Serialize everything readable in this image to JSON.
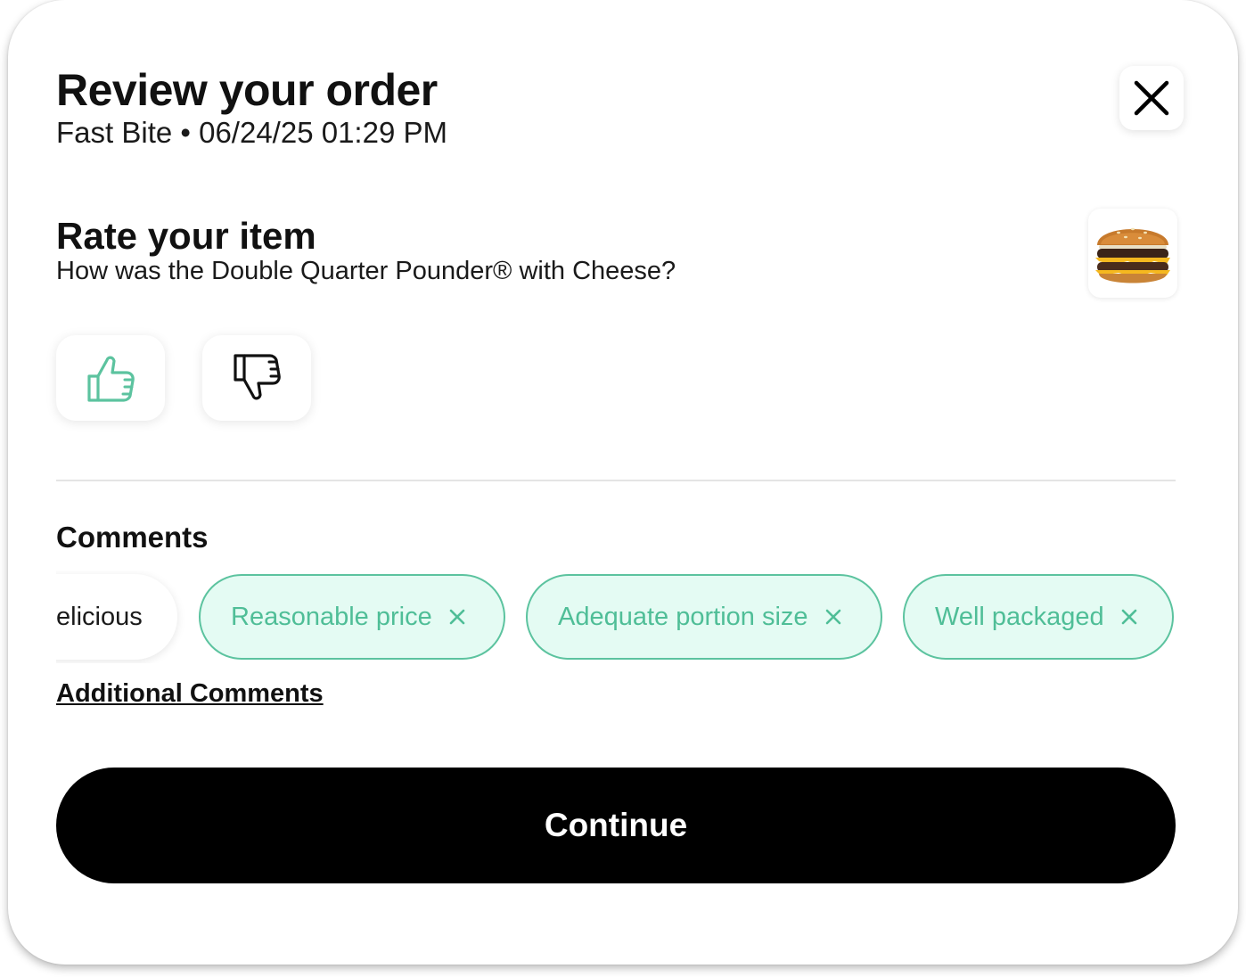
{
  "header": {
    "title": "Review your order",
    "subtitle": "Fast Bite • 06/24/25 01:29 PM",
    "close_icon": "close-icon"
  },
  "rate_item": {
    "title": "Rate your item",
    "question": "How was the Double Quarter Pounder® with Cheese?",
    "item_image_icon": "burger-image",
    "thumbs_up_icon": "thumbs-up-icon",
    "thumbs_down_icon": "thumbs-down-icon",
    "accent_color": "#5cc39f"
  },
  "comments": {
    "title": "Comments",
    "chips": [
      {
        "label": "elicious",
        "selected": false
      },
      {
        "label": "Reasonable price",
        "selected": true
      },
      {
        "label": "Adequate portion size",
        "selected": true
      },
      {
        "label": "Well packaged",
        "selected": true
      }
    ],
    "additional_label": "Additional Comments"
  },
  "footer": {
    "continue_label": "Continue"
  },
  "colors": {
    "chip_selected_bg": "#e4fbf3",
    "chip_selected_border": "#5cc39f",
    "chip_selected_text": "#4fbe97",
    "primary_button": "#000000"
  }
}
